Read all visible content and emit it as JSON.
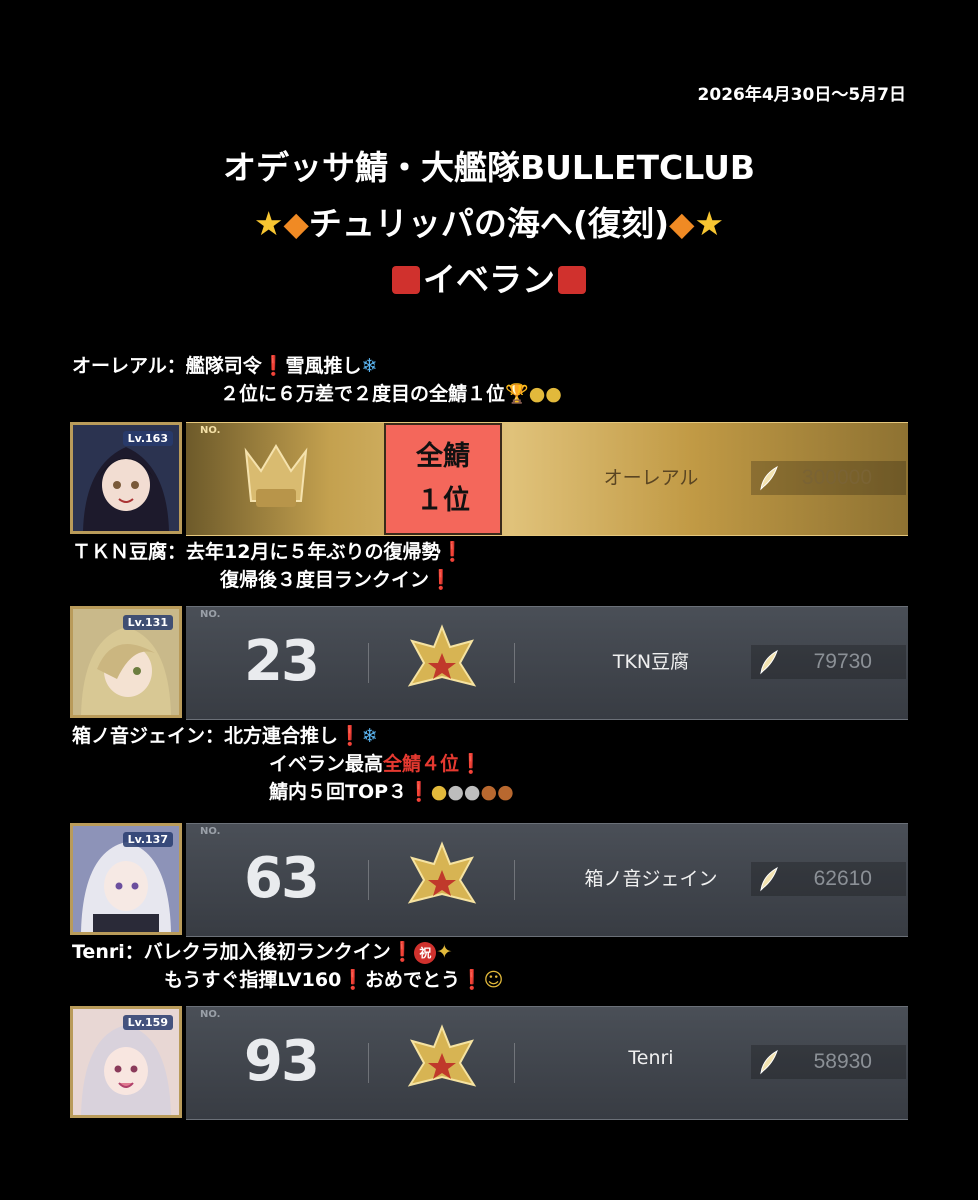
{
  "date": "2026年4月30日〜5月7日",
  "title": {
    "line1": "オデッサ鯖・大艦隊BULLETCLUB",
    "line2_text": "チュリッパの海へ(復刻)",
    "line3_text": "イベラン"
  },
  "entries": [
    {
      "comment_line1": "オーレアル：艦隊司令",
      "comment_line1b": "雪風推し",
      "comment_line2": "２位に６万差で２度目の全鯖１位",
      "level": "Lv.163",
      "rank_badge_line1": "全鯖",
      "rank_badge_line2": "１位",
      "name": "オーレアル",
      "score": "300000",
      "no_label": "NO."
    },
    {
      "comment_line1": "ＴＫＮ豆腐：去年12月に５年ぶりの復帰勢",
      "comment_line2": "復帰後３度目ランクイン",
      "level": "Lv.131",
      "rank": "23",
      "name": "TKN豆腐",
      "score": "79730",
      "no_label": "NO."
    },
    {
      "comment_line1": "箱ノ音ジェイン：北方連合推し",
      "comment_line2a": "イベラン最高",
      "comment_line2b": "全鯖４位",
      "comment_line3": "鯖内５回TOP３",
      "level": "Lv.137",
      "rank": "63",
      "name": "箱ノ音ジェイン",
      "score": "62610",
      "no_label": "NO."
    },
    {
      "comment_line1": "Tenri：バレクラ加入後初ランクイン",
      "comment_line1b": "祝",
      "comment_line2": "もうすぐ指揮LV160",
      "comment_line2b": "おめでとう",
      "level": "Lv.159",
      "rank": "93",
      "name": "Tenri",
      "score": "58930",
      "no_label": "NO."
    }
  ]
}
